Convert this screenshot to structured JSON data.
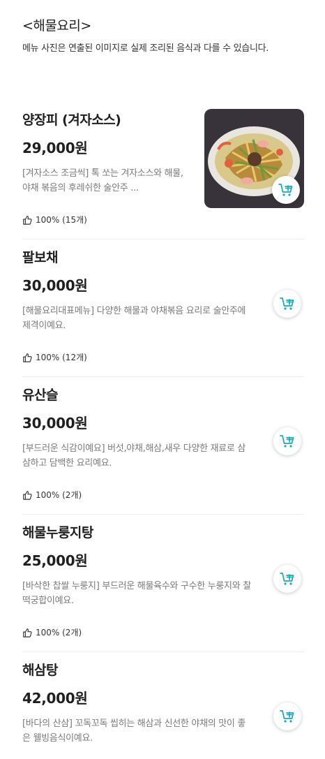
{
  "category": {
    "title": "<해물요리>",
    "description": "메뉴 사진은 연출된 이미지로 실제 조리된 음식과 다를 수 있습니다."
  },
  "colors": {
    "accent": "#1ba7b7",
    "divider": "#eeeeee",
    "desc_text": "#7a7a7a"
  },
  "menu_items": [
    {
      "name": "양장피 (겨자소스)",
      "price": "29,000원",
      "description": "[겨자소스 조금씩] 톡 쏘는 겨자소스와 해물,야채 볶음의 후레쉬한 술안주 ...",
      "rating": "100% (15개)",
      "has_image": true
    },
    {
      "name": "팔보채",
      "price": "30,000원",
      "description": "[해물요리대표메뉴] 다양한 해물과 야채볶음 요리로 술안주에 제격이예요.",
      "rating": "100% (12개)",
      "has_image": false
    },
    {
      "name": "유산슬",
      "price": "30,000원",
      "description": "[부드러운 식감이예요] 버섯,야채,해삼,새우 다양한 재료로 삼삼하고 담백한 요리예요.",
      "rating": "100% (2개)",
      "has_image": false
    },
    {
      "name": "해물누룽지탕",
      "price": "25,000원",
      "description": "[바삭한 찹쌀 누룽지] 부드러운 해물육수와 구수한 누룽지와 찰떡궁합이예요.",
      "rating": "100% (2개)",
      "has_image": false
    },
    {
      "name": "해삼탕",
      "price": "42,000원",
      "description": "[바다의 산삼] 꼬독꼬독 씹히는 해삼과 신선한 야채의 맛이 좋은 웰빙음식이예요.",
      "rating": "",
      "has_image": false
    }
  ],
  "icons": {
    "rating": "thumbs-up-icon",
    "cart": "add-to-cart-icon"
  }
}
